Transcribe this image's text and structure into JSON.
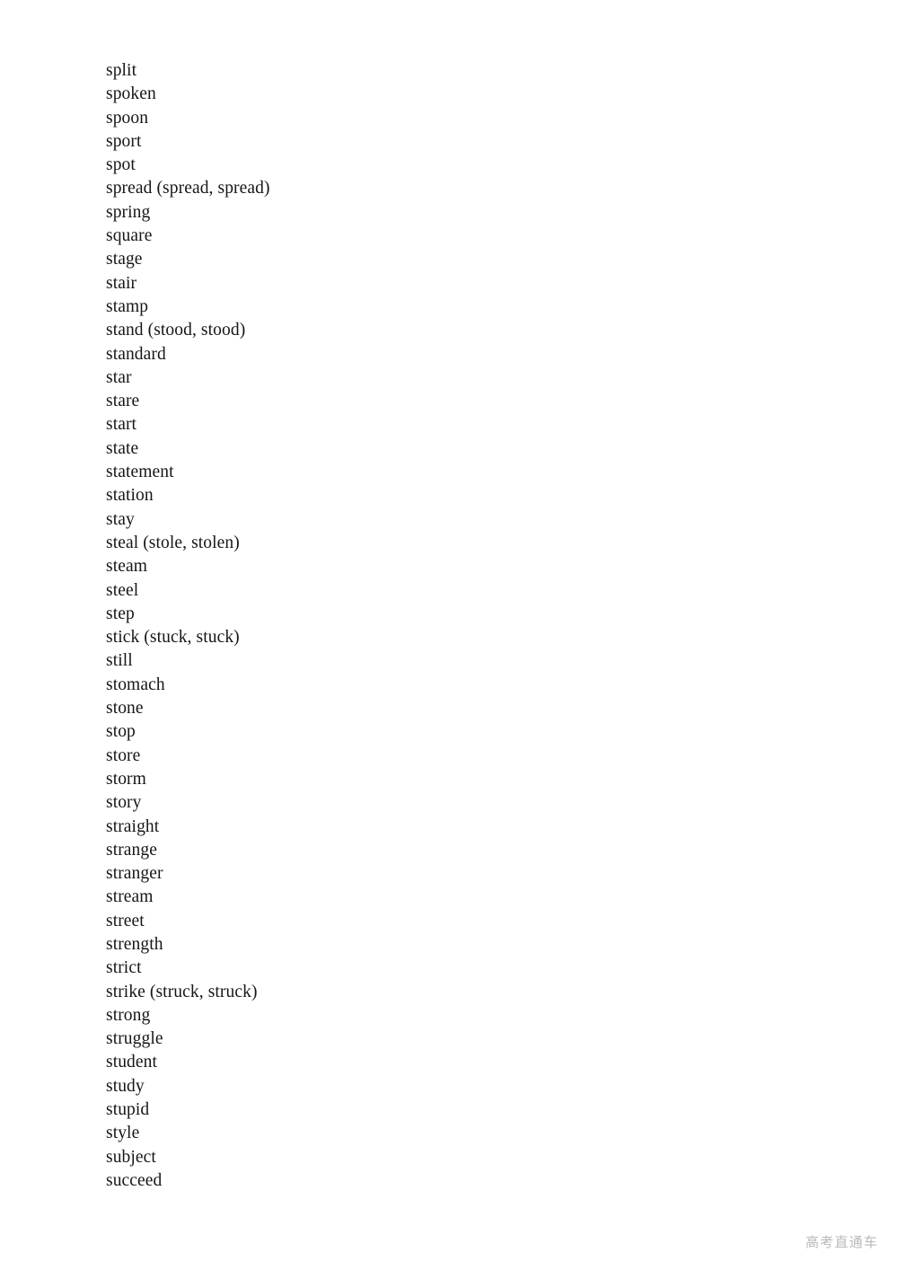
{
  "page": {
    "background_color": "#ffffff",
    "text_color": "#161616",
    "kind": "vocabulary-word-list",
    "section_letter": "s"
  },
  "word_list": {
    "name": "english-vocabulary-entries",
    "count": 48,
    "items": [
      "split",
      "spoken",
      "spoon",
      "sport",
      "spot",
      "spread (spread, spread)",
      "spring",
      "square",
      "stage",
      "stair",
      "stamp",
      "stand (stood, stood)",
      "standard",
      "star",
      "stare",
      "start",
      "state",
      "statement",
      "station",
      "stay",
      "steal (stole, stolen)",
      "steam",
      "steel",
      "step",
      "stick (stuck, stuck)",
      "still",
      "stomach",
      "stone",
      "stop",
      "store",
      "storm",
      "story",
      "straight",
      "strange",
      "stranger",
      "stream",
      "street",
      "strength",
      "strict",
      "strike (struck, struck)",
      "strong",
      "struggle",
      "student",
      "study",
      "stupid",
      "style",
      "subject",
      "succeed"
    ]
  },
  "watermark": {
    "text": "高考直通车",
    "color": "#b9b9b9"
  }
}
